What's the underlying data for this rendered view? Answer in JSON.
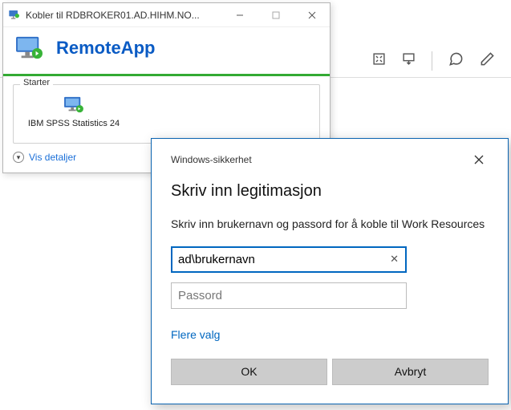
{
  "background_toolbar": {
    "icons": [
      "fullscreen",
      "download",
      "comment",
      "edit"
    ]
  },
  "connect_window": {
    "title": "Kobler til RDBROKER01.AD.HIHM.NO...",
    "brand": "RemoteApp",
    "group_label": "Starter",
    "app_label": "IBM SPSS Statistics 24",
    "details_link": "Vis detaljer"
  },
  "cred_dialog": {
    "title": "Windows-sikkerhet",
    "heading": "Skriv inn legitimasjon",
    "description": "Skriv inn brukernavn og passord for å koble til Work Resources",
    "username_value": "ad\\brukernavn",
    "password_placeholder": "Passord",
    "more_choices": "Flere valg",
    "ok_label": "OK",
    "cancel_label": "Avbryt"
  }
}
